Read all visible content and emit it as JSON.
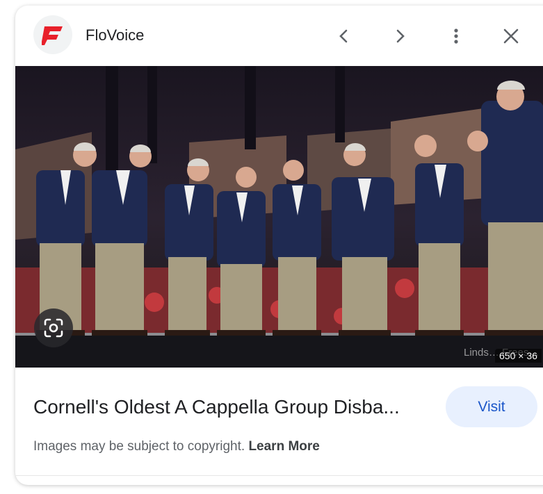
{
  "header": {
    "source_name": "FloVoice",
    "icons": {
      "logo": "flovoice-logo-icon",
      "prev": "chevron-left-icon",
      "next": "chevron-right-icon",
      "more": "more-vertical-icon",
      "close": "close-icon"
    }
  },
  "image": {
    "credit": "Linds… Frees…",
    "dimensions": "650 × 36",
    "lens_icon": "google-lens-icon"
  },
  "result": {
    "title": "Cornell's Oldest A Cappella Group Disba...",
    "visit_label": "Visit"
  },
  "footer": {
    "copyright_text": "Images may be subject to copyright.",
    "learn_more": "Learn More"
  },
  "colors": {
    "visit_bg": "#e8f0fe",
    "visit_text": "#1a56c9",
    "logo_red": "#e8202a"
  }
}
